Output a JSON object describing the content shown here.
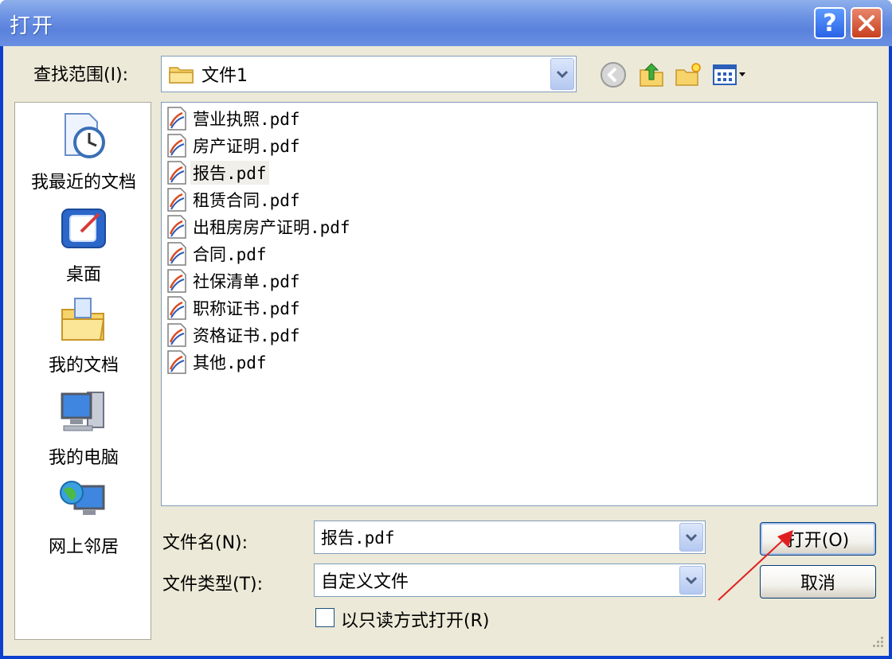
{
  "window": {
    "title": "打开"
  },
  "titlebar": {
    "help_glyph": "?",
    "close_glyph": "✕"
  },
  "lookin": {
    "label": "查找范围(I):",
    "value": "文件1"
  },
  "toolbar_icons": [
    "back-icon",
    "up-folder-icon",
    "new-folder-icon",
    "view-menu-icon"
  ],
  "places": [
    {
      "label": "我最近的文档",
      "icon": "recent-documents-icon"
    },
    {
      "label": "桌面",
      "icon": "desktop-icon"
    },
    {
      "label": "我的文档",
      "icon": "my-documents-icon"
    },
    {
      "label": "我的电脑",
      "icon": "my-computer-icon"
    },
    {
      "label": "网上邻居",
      "icon": "network-places-icon"
    }
  ],
  "files": [
    {
      "name": "营业执照.pdf"
    },
    {
      "name": "房产证明.pdf"
    },
    {
      "name": "报告.pdf",
      "selected": true
    },
    {
      "name": "租赁合同.pdf"
    },
    {
      "name": "出租房房产证明.pdf"
    },
    {
      "name": "合同.pdf"
    },
    {
      "name": "社保清单.pdf"
    },
    {
      "name": "职称证书.pdf"
    },
    {
      "name": "资格证书.pdf"
    },
    {
      "name": "其他.pdf"
    }
  ],
  "filename": {
    "label": "文件名(N):",
    "value": "报告.pdf"
  },
  "filetype": {
    "label": "文件类型(T):",
    "value": "自定义文件"
  },
  "readonly": {
    "label": "以只读方式打开(R)",
    "checked": false
  },
  "buttons": {
    "open": "打开(O)",
    "cancel": "取消"
  },
  "colors": {
    "title_bar": "#6d93e3",
    "client": "#ece9d8",
    "annotation_arrow": "#e02020"
  }
}
